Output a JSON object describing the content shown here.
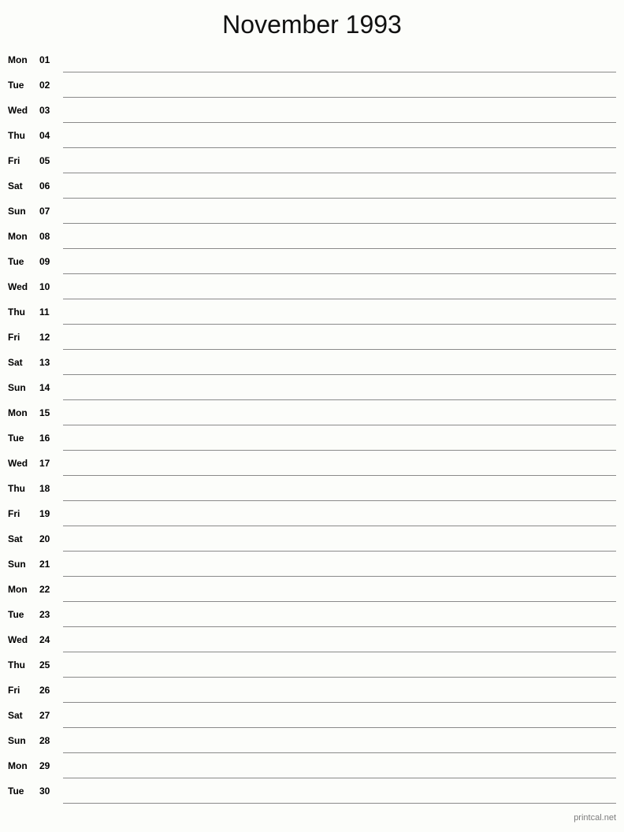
{
  "header": {
    "title": "November 1993",
    "month": "November",
    "year": "1993"
  },
  "footer": {
    "credit": "printcal.net"
  },
  "colors": {
    "background": "#fcfdfa",
    "text": "#000000",
    "rule_line": "#8a8a8a",
    "footer_text": "#7d7d7d"
  },
  "calendar": {
    "layout": "single-column-notes",
    "days_in_month": 30,
    "first_weekday": "Mon",
    "rows": [
      {
        "weekday": "Mon",
        "day": "01",
        "note": ""
      },
      {
        "weekday": "Tue",
        "day": "02",
        "note": ""
      },
      {
        "weekday": "Wed",
        "day": "03",
        "note": ""
      },
      {
        "weekday": "Thu",
        "day": "04",
        "note": ""
      },
      {
        "weekday": "Fri",
        "day": "05",
        "note": ""
      },
      {
        "weekday": "Sat",
        "day": "06",
        "note": ""
      },
      {
        "weekday": "Sun",
        "day": "07",
        "note": ""
      },
      {
        "weekday": "Mon",
        "day": "08",
        "note": ""
      },
      {
        "weekday": "Tue",
        "day": "09",
        "note": ""
      },
      {
        "weekday": "Wed",
        "day": "10",
        "note": ""
      },
      {
        "weekday": "Thu",
        "day": "11",
        "note": ""
      },
      {
        "weekday": "Fri",
        "day": "12",
        "note": ""
      },
      {
        "weekday": "Sat",
        "day": "13",
        "note": ""
      },
      {
        "weekday": "Sun",
        "day": "14",
        "note": ""
      },
      {
        "weekday": "Mon",
        "day": "15",
        "note": ""
      },
      {
        "weekday": "Tue",
        "day": "16",
        "note": ""
      },
      {
        "weekday": "Wed",
        "day": "17",
        "note": ""
      },
      {
        "weekday": "Thu",
        "day": "18",
        "note": ""
      },
      {
        "weekday": "Fri",
        "day": "19",
        "note": ""
      },
      {
        "weekday": "Sat",
        "day": "20",
        "note": ""
      },
      {
        "weekday": "Sun",
        "day": "21",
        "note": ""
      },
      {
        "weekday": "Mon",
        "day": "22",
        "note": ""
      },
      {
        "weekday": "Tue",
        "day": "23",
        "note": ""
      },
      {
        "weekday": "Wed",
        "day": "24",
        "note": ""
      },
      {
        "weekday": "Thu",
        "day": "25",
        "note": ""
      },
      {
        "weekday": "Fri",
        "day": "26",
        "note": ""
      },
      {
        "weekday": "Sat",
        "day": "27",
        "note": ""
      },
      {
        "weekday": "Sun",
        "day": "28",
        "note": ""
      },
      {
        "weekday": "Mon",
        "day": "29",
        "note": ""
      },
      {
        "weekday": "Tue",
        "day": "30",
        "note": ""
      }
    ]
  }
}
